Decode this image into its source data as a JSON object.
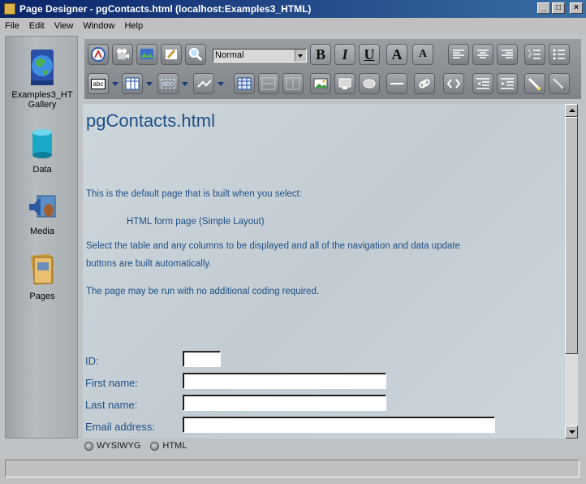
{
  "window": {
    "title": "Page Designer - pgContacts.html  (localhost:Examples3_HTML)"
  },
  "menubar": {
    "items": [
      "File",
      "Edit",
      "View",
      "Window",
      "Help"
    ]
  },
  "sidebar": {
    "items": [
      {
        "label_line1": "Examples3_HT",
        "label_line2": "Gallery",
        "icon": "globe-icon"
      },
      {
        "label": "Data",
        "icon": "database-icon"
      },
      {
        "label": "Media",
        "icon": "speaker-icon"
      },
      {
        "label": "Pages",
        "icon": "folder-icon"
      }
    ]
  },
  "toolbar": {
    "style_select_value": "Normal",
    "bold_label": "B",
    "italic_label": "I",
    "underline_label": "U",
    "grow_font_label": "A",
    "shrink_font_label": "A",
    "textbox_label": "abc",
    "abc_label": "abc"
  },
  "document": {
    "title": "pgContacts.html",
    "intro": "This is the default page that is built when you select:",
    "option": "HTML form page (Simple Layout)",
    "desc_line1": "Select the table and any columns to be displayed and all of the navigation and data update",
    "desc_line2": "buttons are built automatically.",
    "note": "The page may be run with no additional coding required.",
    "fields": [
      {
        "label": "ID:"
      },
      {
        "label": "First name:"
      },
      {
        "label": "Last name:"
      },
      {
        "label": "Email address:"
      }
    ]
  },
  "modes": {
    "wysiwyg": "WYSIWYG",
    "html": "HTML"
  }
}
